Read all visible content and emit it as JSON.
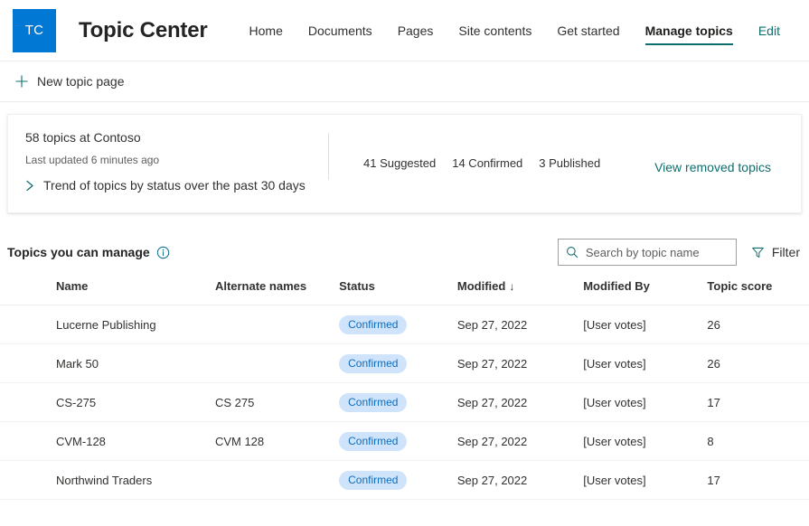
{
  "header": {
    "logo_initials": "TC",
    "site_title": "Topic Center",
    "nav_items": [
      {
        "label": "Home",
        "active": false,
        "link": false
      },
      {
        "label": "Documents",
        "active": false,
        "link": false
      },
      {
        "label": "Pages",
        "active": false,
        "link": false
      },
      {
        "label": "Site contents",
        "active": false,
        "link": false
      },
      {
        "label": "Get started",
        "active": false,
        "link": false
      },
      {
        "label": "Manage topics",
        "active": true,
        "link": false
      },
      {
        "label": "Edit",
        "active": false,
        "link": true
      }
    ]
  },
  "command_bar": {
    "new_topic_page_label": "New topic page",
    "add_icon": "plus-icon"
  },
  "summary_card": {
    "title": "58 topics at Contoso",
    "subtitle": "Last updated 6 minutes ago",
    "trend_label": "Trend of topics by status over the past 30 days",
    "trend_icon": "chevron-right-icon",
    "stats": [
      {
        "label": "41 Suggested"
      },
      {
        "label": "14 Confirmed"
      },
      {
        "label": "3 Published"
      }
    ],
    "removed_topics_link": "View removed topics"
  },
  "section": {
    "title": "Topics you can manage",
    "info_icon": "info-icon",
    "search": {
      "placeholder": "Search by topic name",
      "value": "",
      "icon": "search-icon"
    },
    "filter": {
      "label": "Filter",
      "icon": "filter-icon"
    }
  },
  "table": {
    "columns": [
      {
        "label": "Name"
      },
      {
        "label": "Alternate names"
      },
      {
        "label": "Status"
      },
      {
        "label": "Modified",
        "sorted": true,
        "sort_arrow": "↓"
      },
      {
        "label": "Modified By"
      },
      {
        "label": "Topic score"
      }
    ],
    "rows": [
      {
        "name": "Lucerne Publishing",
        "alternate_names": "",
        "status": "Confirmed",
        "modified": "Sep 27, 2022",
        "modified_by": "[User votes]",
        "topic_score": "26"
      },
      {
        "name": "Mark 50",
        "alternate_names": "",
        "status": "Confirmed",
        "modified": "Sep 27, 2022",
        "modified_by": "[User votes]",
        "topic_score": "26"
      },
      {
        "name": "CS-275",
        "alternate_names": "CS 275",
        "status": "Confirmed",
        "modified": "Sep 27, 2022",
        "modified_by": "[User votes]",
        "topic_score": "17"
      },
      {
        "name": "CVM-128",
        "alternate_names": "CVM 128",
        "status": "Confirmed",
        "modified": "Sep 27, 2022",
        "modified_by": "[User votes]",
        "topic_score": "8"
      },
      {
        "name": "Northwind Traders",
        "alternate_names": "",
        "status": "Confirmed",
        "modified": "Sep 27, 2022",
        "modified_by": "[User votes]",
        "topic_score": "17"
      }
    ]
  },
  "colors": {
    "brand_blue": "#0078d4",
    "teal_accent": "#0f6e6e",
    "status_pill_bg": "#cfe4fa",
    "status_pill_text": "#0f6cbd",
    "text_primary": "#323130",
    "text_secondary": "#605e5c"
  }
}
